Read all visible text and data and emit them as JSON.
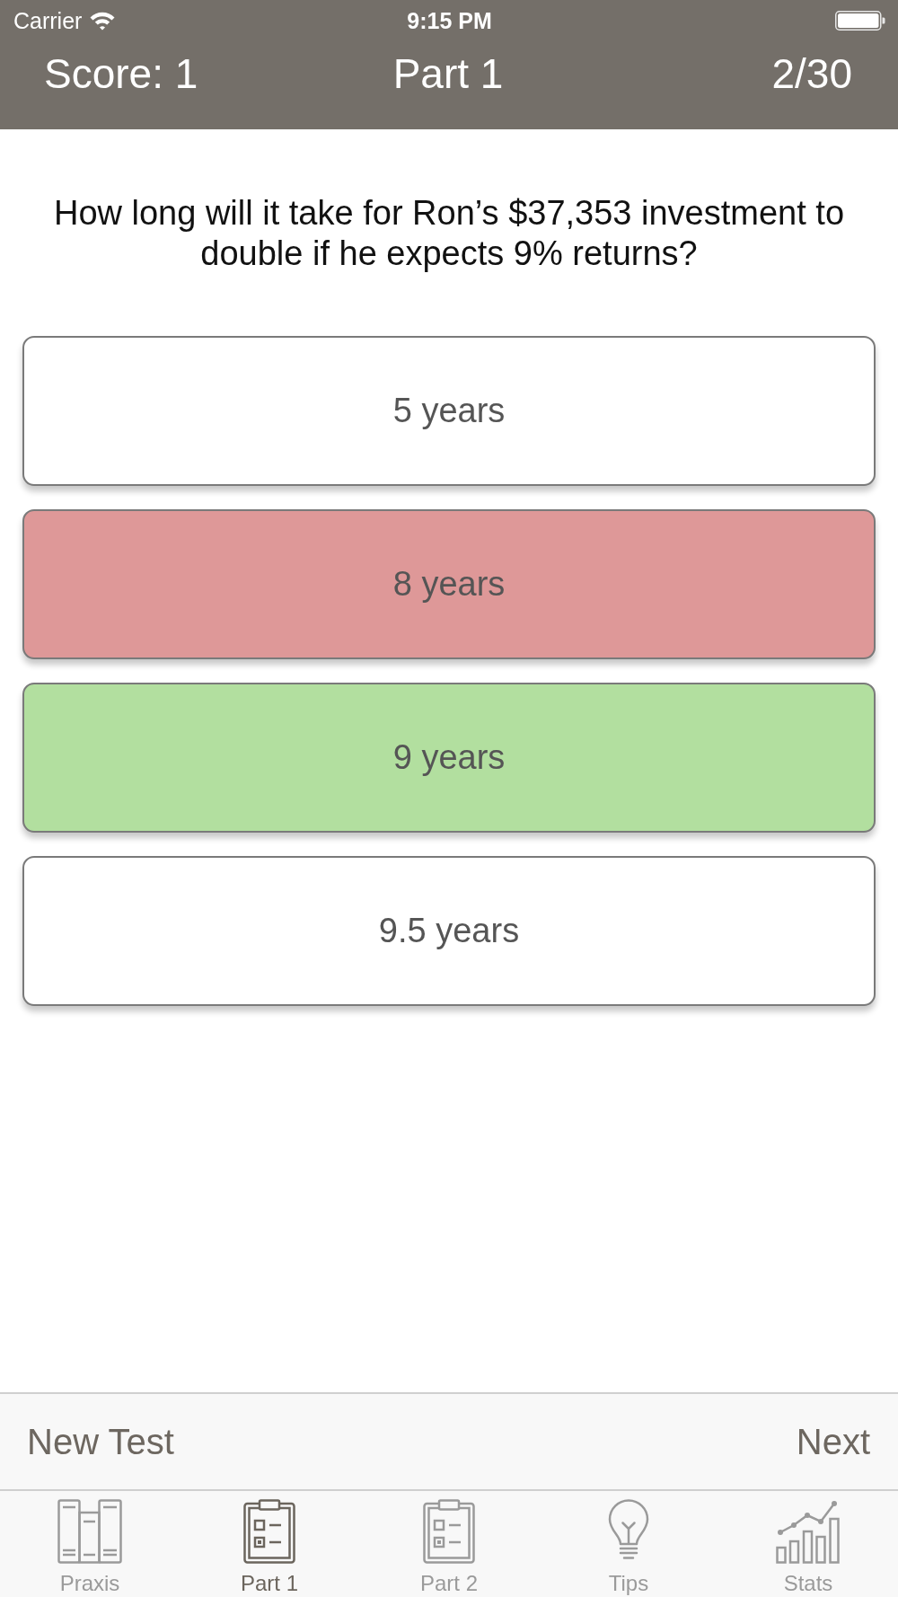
{
  "status_bar": {
    "carrier": "Carrier",
    "time": "9:15 PM"
  },
  "header": {
    "score": "Score: 1",
    "title": "Part 1",
    "progress": "2/30"
  },
  "question": "How long will it take for Ron’s $37,353 investment to double if he expects 9% returns?",
  "answers": [
    {
      "label": "5 years",
      "kind": "plain"
    },
    {
      "label": "8 years",
      "kind": "wrong"
    },
    {
      "label": "9 years",
      "kind": "correct"
    },
    {
      "label": "9.5 years",
      "kind": "plain"
    }
  ],
  "toolbar": {
    "left_button": "New Test",
    "right_button": "Next"
  },
  "tabs": [
    {
      "label": "Praxis",
      "selected": false
    },
    {
      "label": "Part 1",
      "selected": true
    },
    {
      "label": "Part 2",
      "selected": false
    },
    {
      "label": "Tips",
      "selected": false
    },
    {
      "label": "Stats",
      "selected": false
    }
  ]
}
